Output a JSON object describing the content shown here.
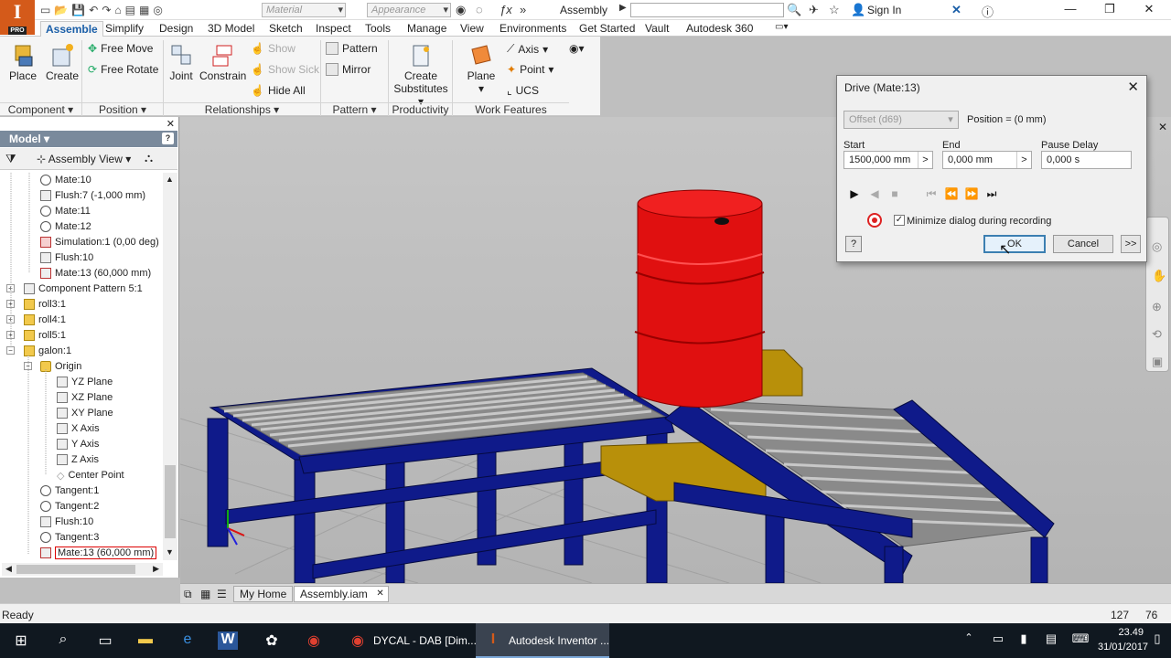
{
  "app": {
    "logo": "I",
    "logo_badge": "PRO",
    "doc_title": "Assembly",
    "material": "Material",
    "appearance": "Appearance",
    "sign_in": "Sign In"
  },
  "tabs": [
    "Assemble",
    "Simplify",
    "Design",
    "3D Model",
    "Sketch",
    "Inspect",
    "Tools",
    "Manage",
    "View",
    "Environments",
    "Get Started",
    "Vault",
    "Autodesk 360"
  ],
  "ribbon": {
    "place": "Place",
    "create": "Create",
    "free_move": "Free Move",
    "free_rotate": "Free Rotate",
    "joint": "Joint",
    "constrain": "Constrain",
    "show": "Show",
    "show_sick": "Show Sick",
    "hide_all": "Hide All",
    "pattern": "Pattern",
    "mirror": "Mirror",
    "create_substitutes_1": "Create",
    "create_substitutes_2": "Substitutes",
    "plane": "Plane",
    "axis": "Axis",
    "point": "Point",
    "ucs": "UCS",
    "groups": [
      "Component",
      "Position",
      "Relationships",
      "Pattern",
      "Productivity",
      "Work Features"
    ]
  },
  "browser": {
    "title": "Model",
    "view": "Assembly View",
    "items": [
      "Mate:10",
      "Flush:7 (-1,000 mm)",
      "Mate:11",
      "Mate:12",
      "Simulation:1 (0,00 deg)",
      "Flush:10",
      "Mate:13 (60,000 mm)",
      "Component Pattern 5:1",
      "roll3:1",
      "roll4:1",
      "roll5:1",
      "galon:1",
      "Origin",
      "YZ Plane",
      "XZ Plane",
      "XY Plane",
      "X Axis",
      "Y Axis",
      "Z Axis",
      "Center Point",
      "Tangent:1",
      "Tangent:2",
      "Flush:10",
      "Tangent:3",
      "Mate:13 (60,000 mm)"
    ]
  },
  "doctabs": [
    "My Home",
    "Assembly.iam"
  ],
  "status": {
    "text": "Ready",
    "x": "127",
    "y": "76"
  },
  "dialog": {
    "title": "Drive (Mate:13)",
    "offset": "Offset (d69)",
    "position": "Position = (0 mm)",
    "start_label": "Start",
    "start_value": "1500,000 mm",
    "end_label": "End",
    "end_value": "0,000 mm",
    "pause_label": "Pause Delay",
    "pause_value": "0,000 s",
    "minimize_label": "Minimize dialog during recording",
    "ok": "OK",
    "cancel": "Cancel",
    "more": ">>"
  },
  "taskbar": {
    "apps": [
      "DYCAL - DAB [Dim...",
      "Autodesk Inventor ..."
    ],
    "time": "23.49",
    "date": "31/01/2017"
  },
  "colors": {
    "frame": "#0f1a8a",
    "barrel": "#e01010",
    "roller": "#9a9a9a",
    "bracket": "#b8900a",
    "accent": "#1b5fa8"
  }
}
